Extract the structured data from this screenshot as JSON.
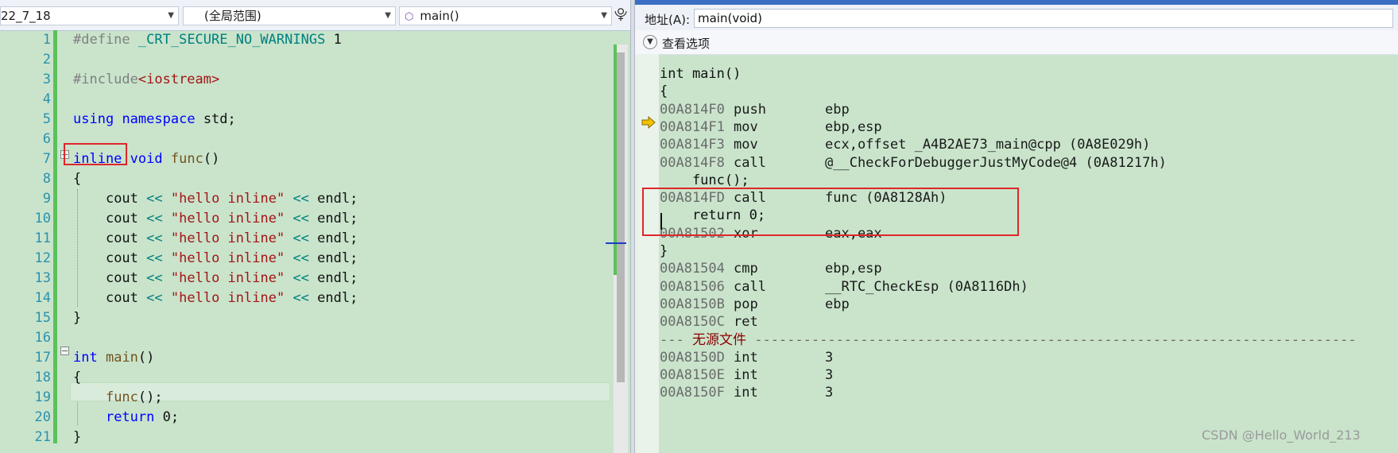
{
  "nav": {
    "project": "22_7_18",
    "scope": "(全局范围)",
    "function": "main()",
    "split_glyph": "⯓"
  },
  "editor": {
    "line_numbers": [
      "1",
      "2",
      "3",
      "4",
      "5",
      "6",
      "7",
      "8",
      "9",
      "10",
      "11",
      "12",
      "13",
      "14",
      "15",
      "16",
      "17",
      "18",
      "19",
      "20",
      "21"
    ],
    "lines": {
      "l1": {
        "pp": "#define",
        "macro": "_CRT_SECURE_NO_WARNINGS",
        "val": "1"
      },
      "l3": {
        "pp": "#include",
        "hdr": "<iostream>"
      },
      "l5": {
        "k1": "using",
        "k2": "namespace",
        "id": "std",
        "semi": ";"
      },
      "l7": {
        "k1": "inline",
        "k2": "void",
        "fn": "func",
        "rest": "()"
      },
      "l8": "{",
      "cout_line": {
        "id": "cout",
        "op": "<<",
        "str": "\"hello inline\"",
        "op2": "<<",
        "end": "endl",
        "semi": ";"
      },
      "l15": "}",
      "l17": {
        "k1": "int",
        "fn": "main",
        "rest": "()"
      },
      "l18": "{",
      "l19": {
        "fn": "func",
        "rest": "();"
      },
      "l20": {
        "k1": "return",
        "rest": "0;"
      },
      "l21": "}"
    }
  },
  "disasm": {
    "address_label": "地址(A):",
    "address_value": "main(void)",
    "options_label": "查看选项",
    "rows": [
      {
        "type": "src",
        "text": "int main()"
      },
      {
        "type": "src",
        "text": "{"
      },
      {
        "type": "ins",
        "addr": "00A814F0",
        "op": "push",
        "args": "ebp"
      },
      {
        "type": "ins",
        "addr": "00A814F1",
        "op": "mov",
        "args": "ebp,esp"
      },
      {
        "type": "ins",
        "addr": "00A814F3",
        "op": "mov",
        "args": "ecx,offset _A4B2AE73_main@cpp (0A8E029h)"
      },
      {
        "type": "ins",
        "addr": "00A814F8",
        "op": "call",
        "args": "@__CheckForDebuggerJustMyCode@4 (0A81217h)"
      },
      {
        "type": "src",
        "text": "    func();"
      },
      {
        "type": "ins",
        "addr": "00A814FD",
        "op": "call",
        "args": "func (0A8128Ah)"
      },
      {
        "type": "src",
        "text": "    return 0;"
      },
      {
        "type": "ins",
        "addr": "00A81502",
        "op": "xor",
        "args": "eax,eax"
      },
      {
        "type": "src",
        "text": "}"
      },
      {
        "type": "ins",
        "addr": "00A81504",
        "op": "cmp",
        "args": "ebp,esp"
      },
      {
        "type": "ins",
        "addr": "00A81506",
        "op": "call",
        "args": "__RTC_CheckEsp (0A8116Dh)"
      },
      {
        "type": "ins",
        "addr": "00A8150B",
        "op": "pop",
        "args": "ebp"
      },
      {
        "type": "ins",
        "addr": "00A8150C",
        "op": "ret",
        "args": ""
      },
      {
        "type": "nosrc",
        "prefix": "---",
        "text": "无源文件",
        "dashes": "--------------------------------------------------------------------------"
      },
      {
        "type": "ins",
        "addr": "00A8150D",
        "op": "int",
        "args": "3"
      },
      {
        "type": "ins",
        "addr": "00A8150E",
        "op": "int",
        "args": "3"
      },
      {
        "type": "ins",
        "addr": "00A8150F",
        "op": "int",
        "args": "3"
      }
    ]
  },
  "watermark": "CSDN @Hello_World_213",
  "colors": {
    "editor_bg": "#c9e4cb",
    "keyword": "#0000ff",
    "string": "#a31515",
    "highlight_box": "#e0262a",
    "exec_arrow": "#f2c200"
  }
}
